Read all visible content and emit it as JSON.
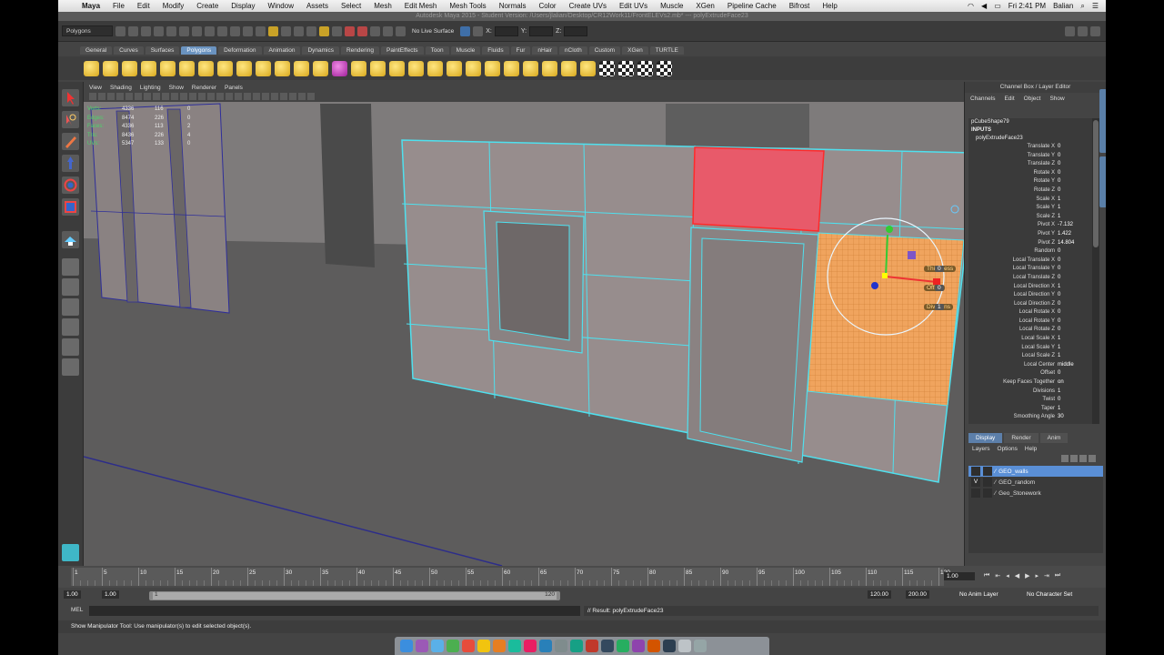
{
  "macmenu": {
    "app": "Maya",
    "items": [
      "File",
      "Edit",
      "Modify",
      "Create",
      "Display",
      "Window",
      "Assets",
      "Select",
      "Mesh",
      "Edit Mesh",
      "Mesh Tools",
      "Normals",
      "Color",
      "Create UVs",
      "Edit UVs",
      "Muscle",
      "XGen",
      "Pipeline Cache",
      "Bifrost",
      "Help"
    ],
    "clock": "Fri 2:41 PM",
    "user": "Balian"
  },
  "window_title": "Autodesk Maya 2015 - Student Version: /Users/jlalian/Desktop/CR12Work11/FrontELEVs2.mb* --- polyExtrudeFace23",
  "status_line": {
    "mode": "Polygons",
    "live_surface": "No Live Surface",
    "x_label": "X:",
    "y_label": "Y:",
    "z_label": "Z:"
  },
  "shelf": {
    "tabs": [
      "General",
      "Curves",
      "Surfaces",
      "Polygons",
      "Deformation",
      "Animation",
      "Dynamics",
      "Rendering",
      "PaintEffects",
      "Toon",
      "Muscle",
      "Fluids",
      "Fur",
      "nHair",
      "nCloth",
      "Custom",
      "XGen",
      "TURTLE"
    ],
    "active_tab": "Polygons"
  },
  "viewport": {
    "menu": [
      "View",
      "Shading",
      "Lighting",
      "Show",
      "Renderer",
      "Panels"
    ],
    "hud": [
      {
        "label": "Verts:",
        "a": "4336",
        "b": "116",
        "c": "0"
      },
      {
        "label": "Edges:",
        "a": "8474",
        "b": "226",
        "c": "0"
      },
      {
        "label": "Faces:",
        "a": "4336",
        "b": "113",
        "c": "2"
      },
      {
        "label": "Tris:",
        "a": "8436",
        "b": "226",
        "c": "4"
      },
      {
        "label": "UVs:",
        "a": "5347",
        "b": "133",
        "c": "0"
      }
    ],
    "sliders": [
      {
        "label": "Thickness",
        "value": "0"
      },
      {
        "label": "Offset",
        "value": "0"
      },
      {
        "label": "Divisions",
        "value": "1"
      }
    ]
  },
  "channel_box": {
    "header": "Channel Box / Layer Editor",
    "menu": [
      "Channels",
      "Edit",
      "Object",
      "Show"
    ],
    "object": "pCubeShape79",
    "section": "INPUTS",
    "node": "polyExtrudeFace23",
    "attributes": [
      {
        "name": "Translate X",
        "value": "0"
      },
      {
        "name": "Translate Y",
        "value": "0"
      },
      {
        "name": "Translate Z",
        "value": "0"
      },
      {
        "name": "Rotate X",
        "value": "0"
      },
      {
        "name": "Rotate Y",
        "value": "0"
      },
      {
        "name": "Rotate Z",
        "value": "0"
      },
      {
        "name": "Scale X",
        "value": "1"
      },
      {
        "name": "Scale Y",
        "value": "1"
      },
      {
        "name": "Scale Z",
        "value": "1"
      },
      {
        "name": "Pivot X",
        "value": "-7.132"
      },
      {
        "name": "Pivot Y",
        "value": "1.422"
      },
      {
        "name": "Pivot Z",
        "value": "14.804"
      },
      {
        "name": "Random",
        "value": "0"
      },
      {
        "name": "Local Translate X",
        "value": "0"
      },
      {
        "name": "Local Translate Y",
        "value": "0"
      },
      {
        "name": "Local Translate Z",
        "value": "0"
      },
      {
        "name": "Local Direction X",
        "value": "1"
      },
      {
        "name": "Local Direction Y",
        "value": "0"
      },
      {
        "name": "Local Direction Z",
        "value": "0"
      },
      {
        "name": "Local Rotate X",
        "value": "0"
      },
      {
        "name": "Local Rotate Y",
        "value": "0"
      },
      {
        "name": "Local Rotate Z",
        "value": "0"
      },
      {
        "name": "Local Scale X",
        "value": "1"
      },
      {
        "name": "Local Scale Y",
        "value": "1"
      },
      {
        "name": "Local Scale Z",
        "value": "1"
      },
      {
        "name": "Local Center",
        "value": "middle"
      },
      {
        "name": "Offset",
        "value": "0"
      },
      {
        "name": "Keep Faces Together",
        "value": "on"
      },
      {
        "name": "Divisions",
        "value": "1"
      },
      {
        "name": "Twist",
        "value": "0"
      },
      {
        "name": "Taper",
        "value": "1"
      },
      {
        "name": "Smoothing Angle",
        "value": "30"
      }
    ],
    "side_tabs": [
      "Channel Box / Layer Editor",
      "Attribute Editor"
    ]
  },
  "layers": {
    "tabs": [
      "Display",
      "Render",
      "Anim"
    ],
    "active_tab": "Display",
    "menu": [
      "Layers",
      "Options",
      "Help"
    ],
    "rows": [
      {
        "name": "GEO_walls",
        "visible": "",
        "selected": true
      },
      {
        "name": "GEO_random",
        "visible": "V",
        "selected": false
      },
      {
        "name": "Geo_Stonework",
        "visible": "",
        "selected": false
      }
    ]
  },
  "timeline": {
    "ticks": [
      "1",
      "5",
      "10",
      "15",
      "20",
      "25",
      "30",
      "35",
      "40",
      "45",
      "50",
      "55",
      "60",
      "65",
      "70",
      "75",
      "80",
      "85",
      "90",
      "95",
      "100",
      "105",
      "110",
      "115",
      "120"
    ],
    "current_frame": "1.00",
    "range_start": "1.00",
    "anim_start": "1.00",
    "slider_start": "1",
    "slider_end": "120",
    "range_end": "120.00",
    "anim_end": "200.00",
    "anim_layer": "No Anim Layer",
    "character_set": "No Character Set"
  },
  "command_line": {
    "label": "MEL",
    "result": "// Result: polyExtrudeFace23"
  },
  "help_line": "Show Manipulator Tool: Use manipulator(s) to edit selected object(s).",
  "colors": {
    "wireframe": "#4fe0ee",
    "selected_face": "#e85a6a",
    "extrude_face": "#f0a45e",
    "layer_selected": "#5a8fd6"
  }
}
